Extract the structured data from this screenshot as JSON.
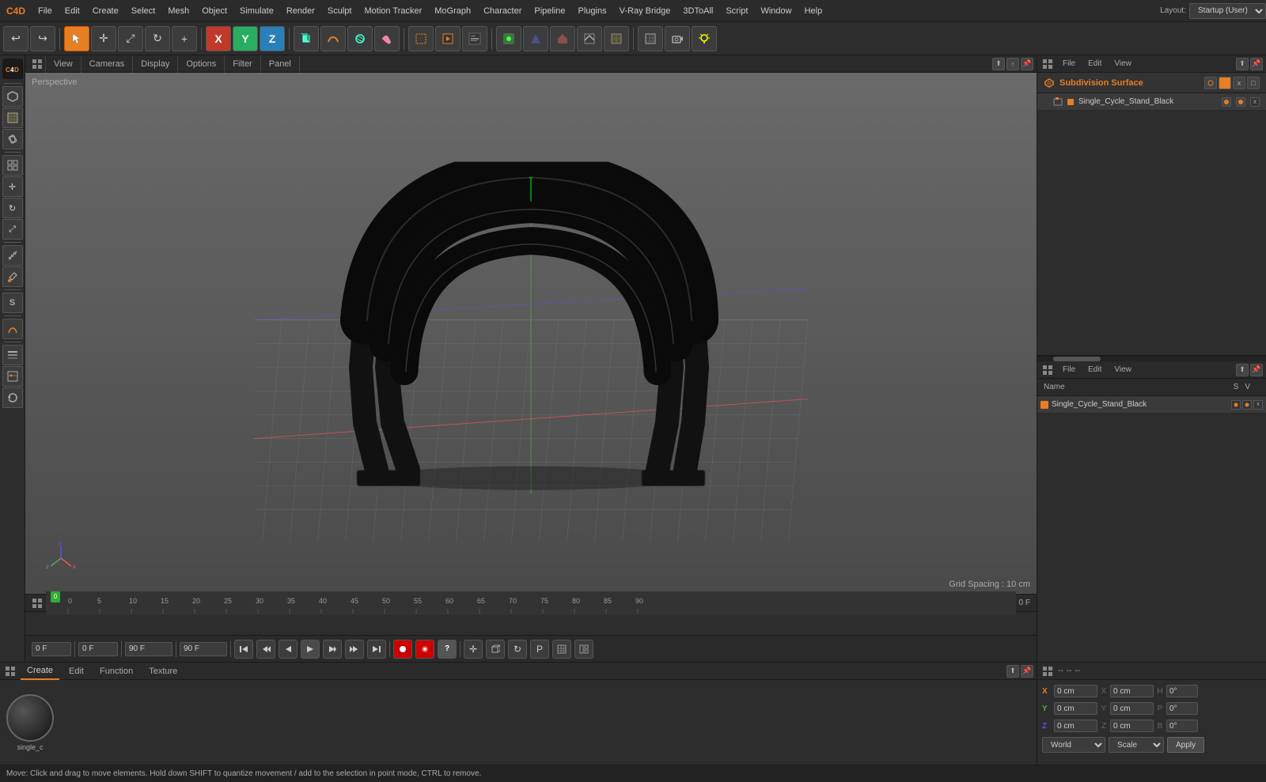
{
  "app": {
    "title": "Cinema 4D",
    "layout_label": "Layout:",
    "layout_value": "Startup (User)"
  },
  "menubar": {
    "items": [
      "File",
      "Edit",
      "Create",
      "Select",
      "Mesh",
      "Object",
      "Simulate",
      "Render",
      "Sculpt",
      "Motion Tracker",
      "MoGraph",
      "Character",
      "Pipeline",
      "Plugins",
      "V-Ray Bridge",
      "3DToAll",
      "Script",
      "Window",
      "Help"
    ]
  },
  "toolbar": {
    "undo_label": "↩",
    "redo_label": "↪"
  },
  "viewport": {
    "perspective_label": "Perspective",
    "tabs": [
      "View",
      "Cameras",
      "Display",
      "Options",
      "Filter",
      "Panel"
    ],
    "grid_spacing": "Grid Spacing : 10 cm"
  },
  "right_panel": {
    "file_label": "File",
    "edit_label": "Edit",
    "view_label": "View",
    "object_name": "Subdivision Surface",
    "child_name": "Single_Cycle_Stand_Black",
    "s_col": "S",
    "v_col": "V",
    "name_col": "Name"
  },
  "timeline": {
    "start_frame": "0",
    "end_frame": "90 F",
    "current_frame": "0 F",
    "frame_field": "0 F",
    "ticks": [
      0,
      5,
      10,
      15,
      20,
      25,
      30,
      35,
      40,
      45,
      50,
      55,
      60,
      65,
      70,
      75,
      80,
      85,
      90
    ],
    "end_display": "0 F"
  },
  "bottom_panel": {
    "tabs": [
      "Create",
      "Edit",
      "Function",
      "Texture"
    ],
    "material_name": "single_c"
  },
  "attributes": {
    "x_label": "X",
    "y_label": "Y",
    "z_label": "Z",
    "x_pos": "0 cm",
    "y_pos": "0 cm",
    "z_pos": "0 cm",
    "h_label": "H",
    "p_label": "P",
    "b_label": "B",
    "h_val": "0°",
    "p_val": "0°",
    "b_val": "0°",
    "x_size": "0 cm",
    "y_size": "0 cm",
    "z_size": "0 cm",
    "world_label": "World",
    "scale_label": "Scale",
    "apply_label": "Apply"
  },
  "statusbar": {
    "text": "Move: Click and drag to move elements. Hold down SHIFT to quantize movement / add to the selection in point mode, CTRL to remove."
  },
  "icons": {
    "undo": "↩",
    "redo": "↪",
    "move": "✛",
    "scale": "⤢",
    "rotate": "↻",
    "select": "↖",
    "play": "▶",
    "pause": "⏸",
    "stop": "⏹",
    "prev": "⏮",
    "next": "⏭",
    "rewind": "⏪",
    "forward": "⏩",
    "key": "◆",
    "record": "⏺",
    "question": "?",
    "lock": "🔒"
  }
}
